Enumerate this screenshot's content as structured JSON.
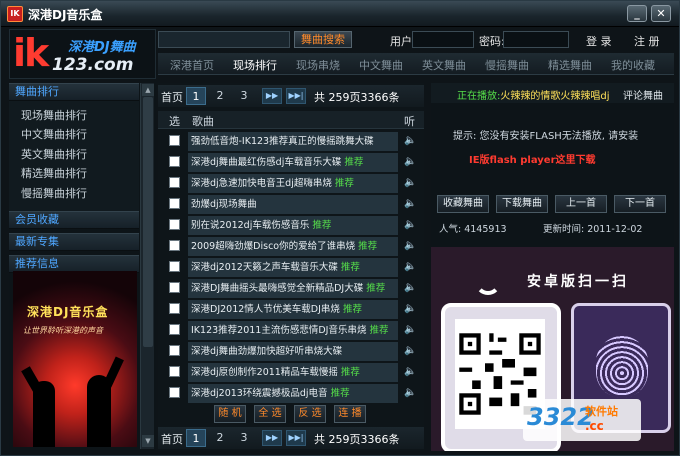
{
  "window": {
    "title": "深港DJ音乐盒",
    "icon_label": "IK",
    "minimize_label": "_",
    "close_label": "✕"
  },
  "logo": {
    "brand": "ik",
    "brand_cn": "深港DJ舞曲",
    "domain": "123.com"
  },
  "header": {
    "search_placeholder": "",
    "search_button": "舞曲搜索",
    "user_label": "用户:",
    "password_label": "密码:",
    "login_button": "登 录",
    "register_button": "注 册"
  },
  "nav": {
    "tabs": [
      {
        "label": "深港首页",
        "active": false
      },
      {
        "label": "现场排行",
        "active": true
      },
      {
        "label": "现场串烧",
        "active": false
      },
      {
        "label": "中文舞曲",
        "active": false
      },
      {
        "label": "英文舞曲",
        "active": false
      },
      {
        "label": "慢摇舞曲",
        "active": false
      },
      {
        "label": "精选舞曲",
        "active": false
      },
      {
        "label": "我的收藏",
        "active": false
      }
    ]
  },
  "sidebar": {
    "section_rank": "舞曲排行",
    "items": [
      "现场舞曲排行",
      "中文舞曲排行",
      "英文舞曲排行",
      "精选舞曲排行",
      "慢摇舞曲排行"
    ],
    "section_favorites": "会员收藏",
    "section_latest": "最新专集",
    "section_recommend": "推荐信息",
    "scroll_up": "▲",
    "scroll_down": "▼",
    "banner_title": "深港DJ音乐盒",
    "banner_subtitle": "让世界聆听深港的声音"
  },
  "list": {
    "pager": {
      "first_label": "首页",
      "pages": [
        "1",
        "2",
        "3"
      ],
      "next_label": "▶▶",
      "last_label": "▶▶|",
      "total": "共 259页3366条"
    },
    "headers": {
      "select": "选",
      "song": "歌曲",
      "listen": "听"
    },
    "speaker_icon": "🔈",
    "recommend_tag": "推荐",
    "rows": [
      {
        "title": "强劲低音炮-IK123推荐真正的慢摇跳舞大碟",
        "recommend": false
      },
      {
        "title": "深港dj舞曲最红伤感dj车载音乐大碟",
        "recommend": true
      },
      {
        "title": "深港dj急速加快电音王dj超嗨串烧",
        "recommend": true
      },
      {
        "title": "劲爆dj现场舞曲",
        "recommend": false
      },
      {
        "title": "别在说2012dj车载伤感音乐",
        "recommend": true
      },
      {
        "title": "2009超嗨劲爆Disco你的爱给了谁串烧",
        "recommend": true
      },
      {
        "title": "深港dj2012天籁之声车载音乐大碟",
        "recommend": true
      },
      {
        "title": "深港DJ舞曲摇头最嗨感觉全新精品DJ大碟",
        "recommend": true
      },
      {
        "title": "深港DJ2012情人节优美车载DJ串烧",
        "recommend": true
      },
      {
        "title": "IK123推荐2011主流伤感悲情DJ音乐串烧",
        "recommend": true
      },
      {
        "title": "深港dj舞曲劲爆加快超好听串烧大碟",
        "recommend": false
      },
      {
        "title": "深港dj原创制作2011精品车载慢摇",
        "recommend": true
      },
      {
        "title": "深港dj2013环绕震撼极品dj电音",
        "recommend": true
      }
    ],
    "actions": [
      "随 机",
      "全 选",
      "反 选",
      "连 播"
    ]
  },
  "right": {
    "now_playing_label": "正在播放:",
    "now_playing_song": "火辣辣的情歌火辣辣唱dj",
    "comment_tab": "评论舞曲",
    "tip": "提示: 您没有安装FLASH无法播放, 请安装",
    "download_link": "IE版flash player这里下载",
    "buttons": [
      "收藏舞曲",
      "下载舞曲",
      "上一首",
      "下一首"
    ],
    "popularity": "人气: 4145913",
    "updated": "更新时间: 2011-12-02",
    "promo_title": "安卓版扫一扫"
  },
  "watermark": {
    "number": "3322",
    "site_label": "软件站",
    "tld": ".cc"
  }
}
